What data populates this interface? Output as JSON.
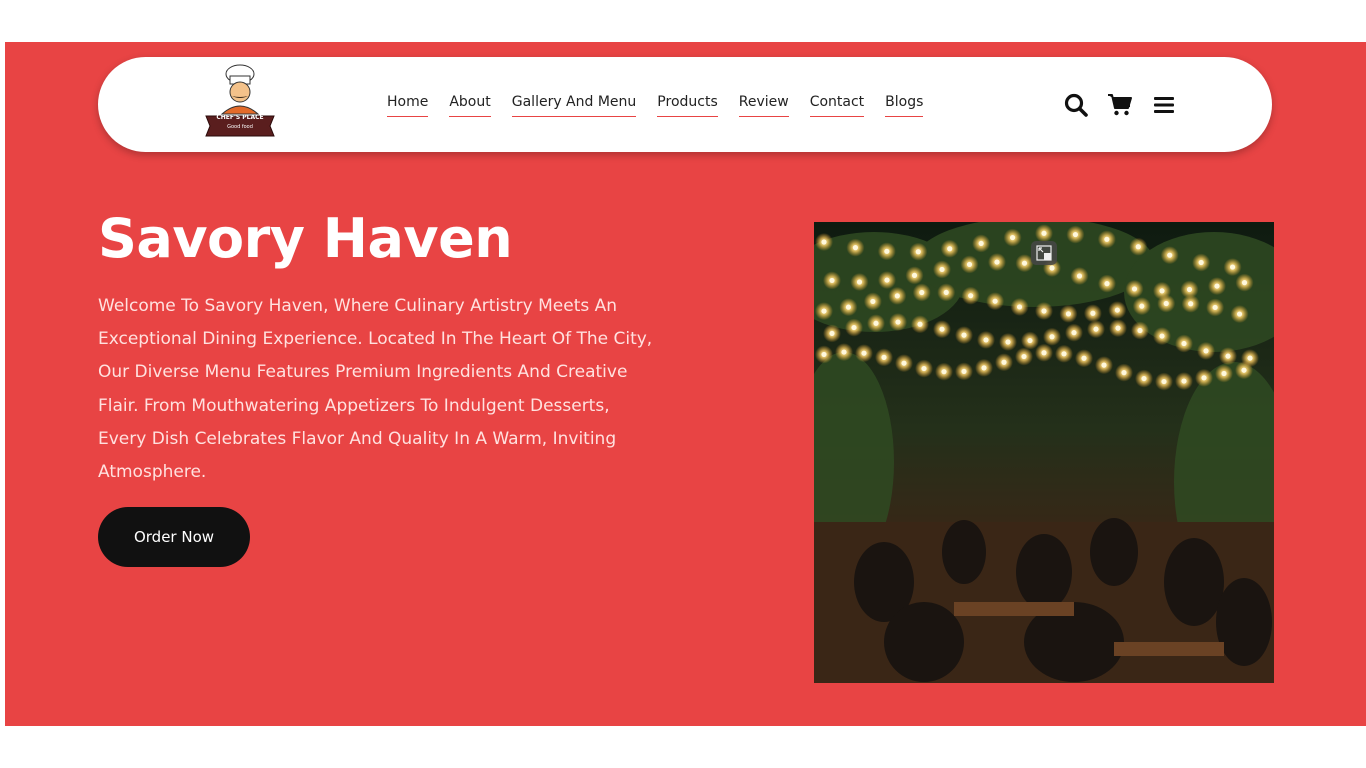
{
  "brand": {
    "logo_line1": "CHEF'S PLACE",
    "logo_line2": "Good food"
  },
  "nav": {
    "links": [
      "Home",
      "About",
      "Gallery And Menu",
      "Products",
      "Review",
      "Contact",
      "Blogs"
    ],
    "icons": [
      "search-icon",
      "cart-icon",
      "menu-icon"
    ]
  },
  "hero": {
    "title": "Savory Haven",
    "description": "Welcome To Savory Haven, Where Culinary Artistry Meets An Exceptional Dining Experience. Located In The Heart Of The City, Our Diverse Menu Features Premium Ingredients And Creative Flair. From Mouthwatering Appetizers To Indulgent Desserts, Every Dish Celebrates Flavor And Quality In A Warm, Inviting Atmosphere.",
    "cta_label": "Order Now",
    "image_alt": "restaurant-patio-photo"
  },
  "colors": {
    "accent": "#e84444",
    "button": "#111111",
    "text_light": "#ffe1df"
  }
}
